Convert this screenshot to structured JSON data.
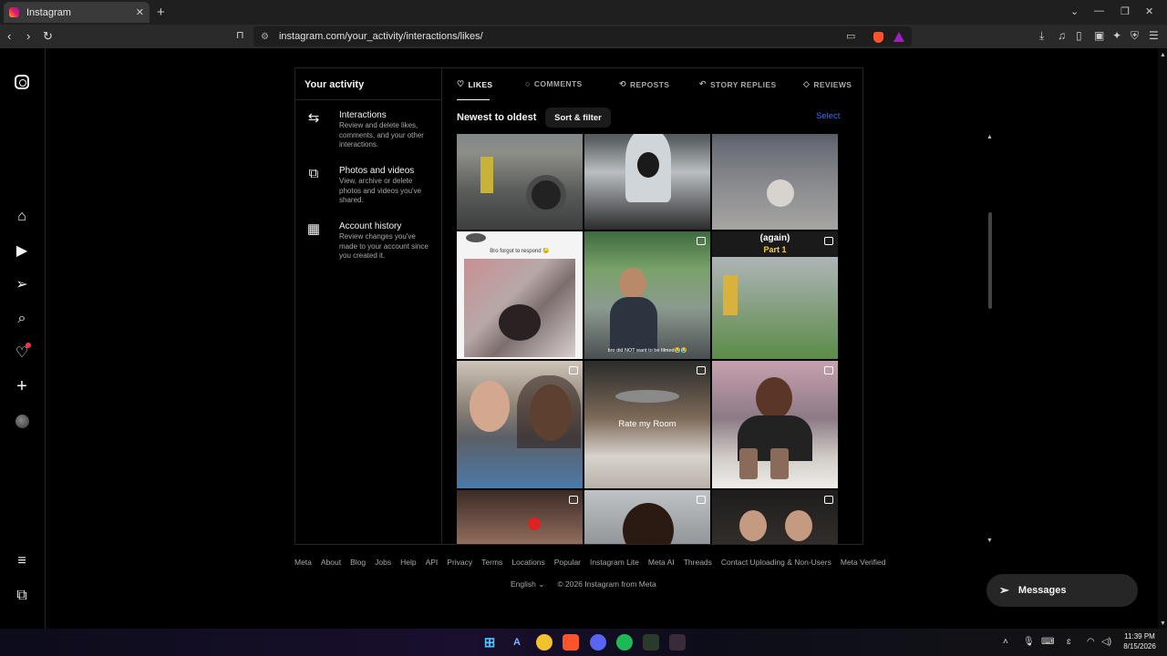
{
  "browser": {
    "tab_title": "Instagram",
    "url": "instagram.com/your_activity/interactions/likes/"
  },
  "panel": {
    "title": "Your activity",
    "side_items": [
      {
        "title": "Interactions",
        "desc": "Review and delete likes, comments, and your other interactions."
      },
      {
        "title": "Photos and videos",
        "desc": "View, archive or delete photos and videos you've shared."
      },
      {
        "title": "Account history",
        "desc": "Review changes you've made to your account since you created it."
      }
    ],
    "tabs": [
      "LIKES",
      "COMMENTS",
      "REPOSTS",
      "STORY REPLIES",
      "REVIEWS"
    ],
    "sort_label": "Newest to oldest",
    "sort_button": "Sort & filter",
    "select": "Select",
    "tile_captions": {
      "t3_top": "Bro forgot to respond 😓",
      "t5_bottom": "bro did NOT want to be filmed😭😭",
      "t6_top": "(again)",
      "t6_sub": "Part 1",
      "t8": "Rate my Room"
    }
  },
  "footer": {
    "links": [
      "Meta",
      "About",
      "Blog",
      "Jobs",
      "Help",
      "API",
      "Privacy",
      "Terms",
      "Locations",
      "Popular",
      "Instagram Lite",
      "Meta AI",
      "Threads",
      "Contact Uploading & Non-Users",
      "Meta Verified"
    ],
    "language": "English",
    "copyright": "© 2026 Instagram from Meta"
  },
  "messages": "Messages",
  "clock": {
    "time": "11:39 PM",
    "date": "8/15/2026"
  }
}
